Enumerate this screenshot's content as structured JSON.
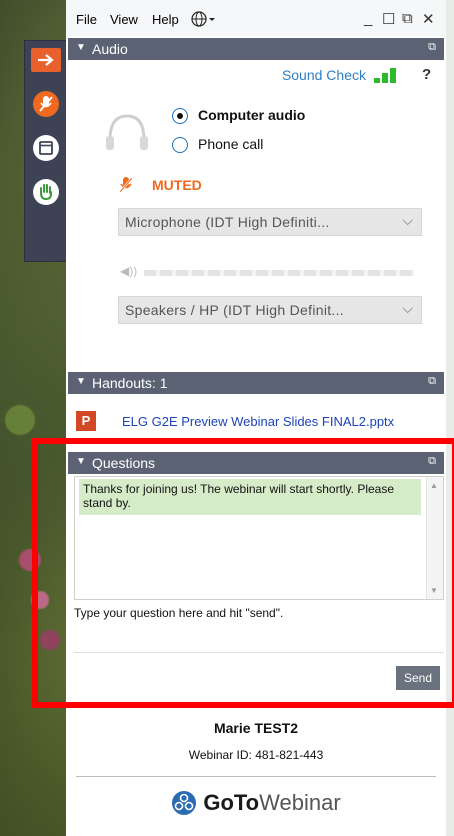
{
  "menu": {
    "file": "File",
    "view": "View",
    "help": "Help",
    "globe_icon": "globe-icon"
  },
  "window_controls": {
    "minimize": "_",
    "restore": "☐",
    "popout": "⧉",
    "close": "✕"
  },
  "audio": {
    "header": "Audio",
    "sound_check": "Sound Check",
    "help": "?",
    "options": [
      {
        "label": "Computer audio",
        "selected": true
      },
      {
        "label": "Phone call",
        "selected": false
      }
    ],
    "status": "MUTED",
    "microphone": "Microphone (IDT High Definiti...",
    "speakers": "Speakers / HP (IDT High Definit..."
  },
  "handouts": {
    "header": "Handouts: 1",
    "items": [
      {
        "icon": "P",
        "name": "ELG G2E Preview Webinar Slides FINAL2.pptx"
      }
    ]
  },
  "questions": {
    "header": "Questions",
    "messages": [
      "Thanks for joining us!  The webinar will start shortly.  Please stand by."
    ],
    "input_placeholder": "Type your question here and hit \"send\".",
    "send_label": "Send"
  },
  "footer": {
    "organizer": "Marie TEST2",
    "webinar_id": "Webinar ID: 481-821-443",
    "brand_goto": "GoTo",
    "brand_webinar": "Webinar"
  },
  "colors": {
    "header_bg": "#5a6273",
    "muted": "#ef6a1f",
    "link": "#1c44b8",
    "accent_orange": "#e8612c",
    "highlight_frame": "#ff0000"
  }
}
